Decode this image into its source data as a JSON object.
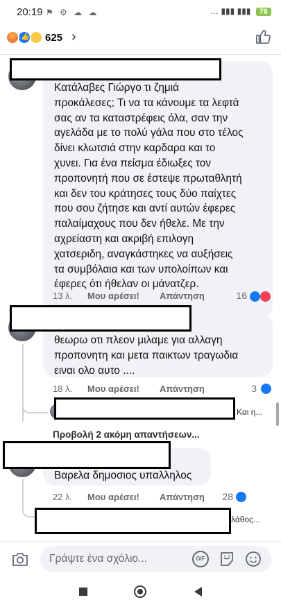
{
  "status_bar": {
    "time": "20:19",
    "left_icons": "⚑ ⚙ ☁ ☁",
    "right_text": "… ▮▮▮ ▮▮▮",
    "battery": "76"
  },
  "header": {
    "reactions": [
      "angry",
      "like",
      "haha"
    ],
    "reaction_count": "625",
    "chevron": "›"
  },
  "comments": [
    {
      "text_lines": [
        "Κατάλαβες Γιώργο τι ζημιά",
        "προκάλεσες; Τι να τα κάνουμε τα λεφτά",
        "σας αν τα καταστρέφεις όλα, σαν την",
        "αγελάδα με το πολύ γάλα που στο τέλος",
        "δίνει κλωτσιά στην καρδαρα και το",
        "χυνει. Για ένα πείσμα έδιωξες τον",
        "προπονητή που σε έστεψε πρωταθλητή",
        "και δεν του κράτησες τους δύο παίχτες",
        "που σου ζήτησε και αντί αυτών έφερες",
        "παλαίμαχους που δεν ήθελε. Με την",
        "αχρείαστη  και ακριβή επιλογη",
        "χατσεριδη, αναγκάστηκες να αυξήσεις",
        "τα συμβόλαια και των υπολοίπων και",
        "έφερες ότι ήθελαν οι μάνατζερ."
      ],
      "time": "13 λ.",
      "like_label": "Μου αρέσει!",
      "reply_label": "Απάντηση",
      "reaction_count": "16"
    },
    {
      "text_lines": [
        "θεωρω οτι πλεον μιλαμε για αλλαγη",
        "προπονητη και μετα παικτων τραγωδια",
        "ειναι ολο αυτο ...."
      ],
      "time": "18 λ.",
      "like_label": "Μου αρέσει!",
      "reply_label": "Απάντηση",
      "reaction_count": "3",
      "reply_snippet": "Και η...",
      "more_replies": "Προβολή 2 ακόμη απαντήσεων..."
    },
    {
      "text_lines": [
        "Βαρελα δημοσιος υπαλληλος"
      ],
      "time": "22 λ.",
      "like_label": "Μου αρέσει!",
      "reply_label": "Απάντηση",
      "reaction_count": "28",
      "reply_snippet": "λάθος..."
    }
  ],
  "composer": {
    "placeholder": "Γράψτε ένα σχόλιο...",
    "gif_label": "GIF"
  },
  "colors": {
    "accent": "#1877f2",
    "love": "#f33e58",
    "bubble": "#f0f2f5",
    "secondary_text": "#65676b"
  },
  "icons": [
    "camera-icon",
    "gif-icon",
    "sticker-icon",
    "emoji-icon",
    "like-icon"
  ]
}
